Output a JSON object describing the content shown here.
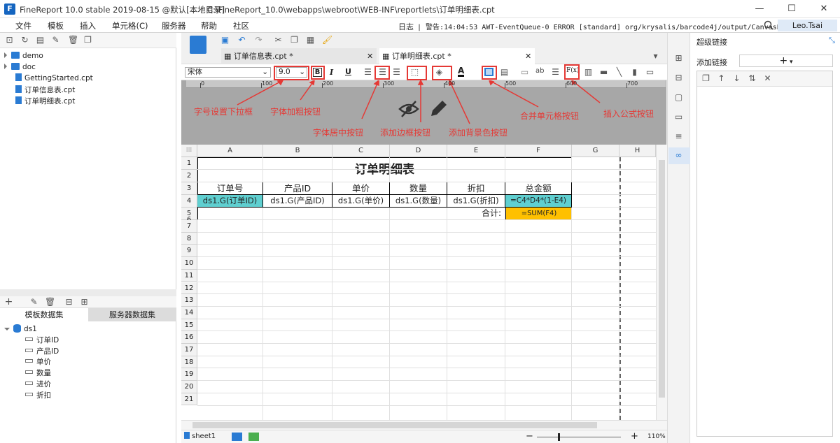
{
  "window": {
    "title": "FineReport 10.0 stable 2019-08-15 @默认[本地目录]",
    "path": "C:\\FineReport_10.0\\webapps\\webroot\\WEB-INF\\reportlets\\订单明细表.cpt",
    "minimize": "—",
    "maximize": "☐",
    "close": "✕"
  },
  "menu": [
    "文件",
    "模板",
    "插入",
    "单元格(C)",
    "服务器",
    "帮助",
    "社区"
  ],
  "status_log": {
    "log_label": "日志",
    "warning": "| 警告:14:04:53 AWT-EventQueue-0 ERROR [standard] org/krysalis/barcode4j/output/CanvasProvider",
    "user": "Leo.Tsai"
  },
  "template_tree": {
    "items": [
      {
        "label": "demo",
        "type": "folder"
      },
      {
        "label": "doc",
        "type": "folder"
      },
      {
        "label": "GettingStarted.cpt",
        "type": "file"
      },
      {
        "label": "订单信息表.cpt",
        "type": "file"
      },
      {
        "label": "订单明细表.cpt",
        "type": "file"
      }
    ]
  },
  "dataset_panel": {
    "tabs": [
      "模板数据集",
      "服务器数据集"
    ],
    "dataset": "ds1",
    "fields": [
      "订单ID",
      "产品ID",
      "单价",
      "数量",
      "进价",
      "折扣"
    ]
  },
  "doc_tabs": [
    {
      "label": "订单信息表.cpt *",
      "active": false
    },
    {
      "label": "订单明细表.cpt *",
      "active": true
    }
  ],
  "format_bar": {
    "font_name": "宋体",
    "font_size": "9.0",
    "bold": "B",
    "italic": "I",
    "underline": "U",
    "text_color_glyph": "A",
    "ab_glyph": "ab",
    "formula_glyph": "F(x)"
  },
  "ruler": [
    "0",
    "100",
    "200",
    "300",
    "400",
    "500",
    "600",
    "700"
  ],
  "annotations": {
    "font_size": "字号设置下拉框",
    "bold": "字体加粗按钮",
    "center": "字体居中按钮",
    "border": "添加边框按钮",
    "bg": "添加背景色按钮",
    "merge": "合并单元格按钮",
    "formula": "插入公式按钮"
  },
  "sheet": {
    "columns": [
      "A",
      "B",
      "C",
      "D",
      "E",
      "F",
      "G",
      "H"
    ],
    "rows": [
      "1",
      "2",
      "3",
      "4",
      "5",
      "6",
      "7",
      "8",
      "9",
      "10",
      "11",
      "12",
      "13",
      "14",
      "15",
      "16",
      "17",
      "18",
      "19",
      "20",
      "21"
    ],
    "title": "订单明细表",
    "headers": [
      "订单号",
      "产品ID",
      "单价",
      "数量",
      "折扣",
      "总金额"
    ],
    "row4": [
      "ds1.G(订单ID)",
      "ds1.G(产品ID)",
      "ds1.G(单价)",
      "ds1.G(数量)",
      "ds1.G(折扣)",
      "=C4*D4*(1-E4)"
    ],
    "total_label": "合计:",
    "total_formula": "=SUM(F4)",
    "colors": {
      "formula_cell": "#5fcfd0",
      "total_cell": "#ffc000",
      "annotation": "#e53935"
    }
  },
  "sheet_tab": "sheet1",
  "zoom": {
    "label": "110%",
    "minus": "−",
    "plus": "+"
  },
  "right_panel": {
    "title": "超级链接",
    "add_label": "添加链接",
    "add_button": "+"
  }
}
